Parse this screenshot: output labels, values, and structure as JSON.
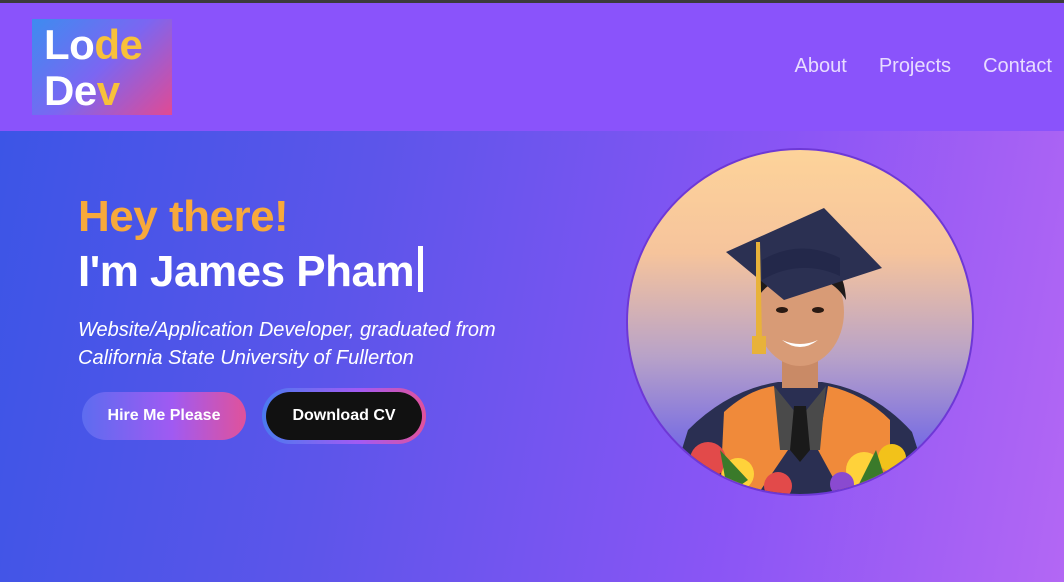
{
  "header": {
    "logo": {
      "line1": {
        "part1": "Lo",
        "part2": "de"
      },
      "line2": {
        "part1": "De",
        "part2": "v"
      }
    },
    "nav": [
      {
        "label": "About"
      },
      {
        "label": "Projects"
      },
      {
        "label": "Contact"
      }
    ]
  },
  "hero": {
    "greeting": "Hey there!",
    "name": "I'm James Pham",
    "subtitle": "Website/Application Developer, graduated from California State University of Fullerton",
    "buttons": {
      "hire": "Hire Me Please",
      "download": "Download CV"
    }
  },
  "colors": {
    "accent": "#f7a93b",
    "nav_bg": "#8a53fb",
    "button_dark": "#111111"
  },
  "icons": {
    "profile": "graduation-portrait"
  }
}
